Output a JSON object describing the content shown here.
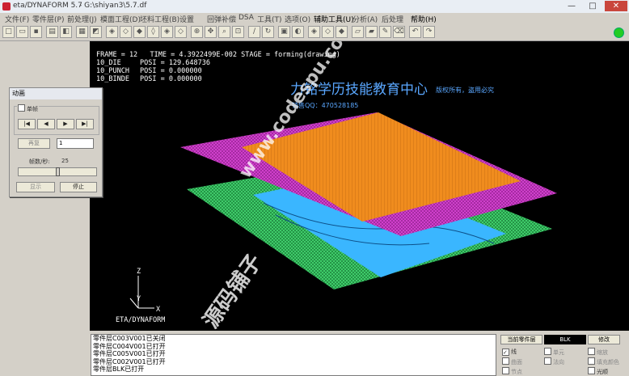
{
  "titlebar": {
    "app_title": "eta/DYNAFORM 5.7",
    "file_path": "- G:\\shiyan3\\5.7.df",
    "minimize_glyph": "—",
    "maximize_glyph": "□",
    "close_glyph": "✕"
  },
  "menu": [
    "文件(F)",
    "零件层(P)",
    "前处理(J)",
    "模面工程(D)",
    "坯料工程(B)",
    "设置",
    "回弹补偿",
    "DSA",
    "工具(T)",
    "选项(O)",
    "辅助工具(U)",
    "分析(A)",
    "后处理",
    "帮助(H)"
  ],
  "viewport": {
    "frame_line": "FRAME = 12   TIME = 4.3922499E-002 STAGE = forming(drawing)",
    "parts": [
      {
        "name": "10_DIE",
        "posi": "POSI = 129.648736"
      },
      {
        "name": "10_PUNCH",
        "posi": "POSI = 0.000000"
      },
      {
        "name": "10_BINDE",
        "posi": "POSI = 0.000000"
      }
    ],
    "watermark_title": "力铭学历技能教育中心",
    "watermark_rights": "版权所有，盗用必究",
    "watermark_qq": "销售QQ：470528185",
    "watermark_site": "www.codespu.com",
    "watermark_cn": "源码铺子",
    "axis_z": "Z",
    "axis_y": "Y",
    "axis_x": "X",
    "brand": "ETA/DYNAFORM",
    "colors": {
      "die": "#f08c1e",
      "punch": "#3ab6ff",
      "binder": "#cc33cc",
      "blank": "#33cc66"
    }
  },
  "dialog": {
    "title": "动画",
    "single_frame_label": "单帧",
    "nav": [
      "|◀",
      "◀",
      "▶",
      "▶|"
    ],
    "reset_label": "再复",
    "frame_value": "1",
    "fps_label": "帧数/秒:",
    "fps_value": "25",
    "fps_fraction": 0.5,
    "show_label": "显示",
    "stop_label": "停止"
  },
  "console": [
    "零件层C003V001已关闭",
    "零件层C004V001已打开",
    "零件层C005V001已打开",
    "零件层C002V001已打开",
    "零件层BLK已打开"
  ],
  "right_panel": {
    "current_part_label": "当前零件层",
    "current_part_value": "BLK",
    "modify_label": "修改",
    "checks": [
      "线",
      "单元",
      "曲面",
      "节点",
      "法向",
      "填充颜色",
      "缩放",
      "光顺"
    ]
  }
}
